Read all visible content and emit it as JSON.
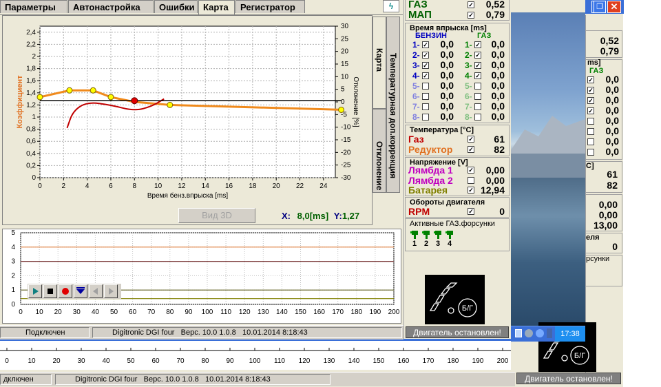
{
  "tabs": [
    "Параметры",
    "Автонастройка",
    "Ошибки",
    "Карта",
    "Регистратор"
  ],
  "side_tabs": [
    "Карта",
    "Температурная доп.коррекция",
    "Отклонение"
  ],
  "chart_data": {
    "type": "line",
    "xlabel": "Время бенз.впрыска [ms]",
    "ylabel": "Коэффициент",
    "y2label": "Отклонение [%]",
    "xlim": [
      0,
      25
    ],
    "ylim": [
      0,
      2.5
    ],
    "y2lim": [
      -30,
      30
    ],
    "x_ticks": [
      0,
      2,
      4,
      6,
      8,
      10,
      12,
      14,
      16,
      18,
      20,
      22,
      24
    ],
    "y_ticks": [
      "0",
      "0,2",
      "0,4",
      "0,6",
      "0,8",
      "1",
      "1,2",
      "1,4",
      "1,6",
      "1,8",
      "2",
      "2,2",
      "2,4"
    ],
    "y2_ticks": [
      "30",
      "25",
      "20",
      "15",
      "10",
      "5",
      "0",
      "-5",
      "-10",
      "-15",
      "-20",
      "-25",
      "-30"
    ],
    "grid": true,
    "series": [
      {
        "color": "#f08a1c",
        "points": [
          [
            0,
            1.33
          ],
          [
            2.5,
            1.44
          ],
          [
            4.5,
            1.44
          ],
          [
            6,
            1.33
          ],
          [
            8,
            1.25
          ],
          [
            11,
            1.2
          ],
          [
            25.5,
            1.12
          ]
        ],
        "markers_x": [
          0,
          2.5,
          4.5,
          6,
          11,
          25.5
        ]
      },
      {
        "color": "#c00000",
        "points": [
          [
            2.3,
            0.82
          ],
          [
            2.8,
            1.1
          ],
          [
            4,
            1.25
          ],
          [
            6,
            1.2
          ],
          [
            8,
            1.1
          ],
          [
            9.5,
            1.18
          ],
          [
            10.5,
            1.3
          ]
        ]
      },
      {
        "color": "#000000",
        "points": [
          [
            0,
            1.27
          ],
          [
            25.5,
            1.27
          ]
        ]
      }
    ],
    "selected_point": [
      8,
      1.27
    ]
  },
  "view3d_label": "Вид 3D",
  "cursor": {
    "x_label": "X:",
    "x_value": "8,0[ms]",
    "y_label": "Y:",
    "y_value": "1,27"
  },
  "lower_chart": {
    "type": "line",
    "x_ticks": [
      0,
      10,
      20,
      30,
      40,
      50,
      60,
      70,
      80,
      90,
      100,
      110,
      120,
      130,
      140,
      150,
      160,
      170,
      180,
      190,
      200
    ],
    "y_ticks": [
      0,
      1,
      2,
      3,
      4,
      5
    ],
    "xlim": [
      0,
      200
    ],
    "ylim": [
      0,
      5
    ],
    "levels": [
      {
        "y": 4.0,
        "color": "#e08040"
      },
      {
        "y": 3.0,
        "color": "#804040"
      },
      {
        "y": 1.0,
        "color": "#606020"
      },
      {
        "y": 0.4,
        "color": "#808000"
      }
    ]
  },
  "back_axis_ticks": [
    0,
    10,
    20,
    30,
    40,
    50,
    60,
    70,
    80,
    90,
    100,
    110,
    120,
    130,
    140,
    150,
    160,
    170,
    180,
    190,
    200
  ],
  "status": {
    "connection": "Подключен",
    "device": "Digitronic DGI four",
    "version": "Верс. 10.0 1.0.8",
    "date": "10.01.2014 8:18:43"
  },
  "back_status": {
    "connection": "дключен",
    "device": "Digitronic DGI four",
    "version": "Верс. 10.0 1.0.8",
    "date": "10.01.2014 8:18:43"
  },
  "top_params": {
    "gas_label": "ГАЗ",
    "gas_value": "0,52",
    "map_label": "МАП",
    "map_value": "0,79"
  },
  "injection": {
    "title": "Время впрыска [ms]",
    "petrol_header": "БЕНЗИН",
    "gas_header": "ГАЗ",
    "rows": [
      {
        "n1": "1-",
        "checked1": true,
        "p": "0,0",
        "n2": "1-",
        "checked2": true,
        "g": "0,0"
      },
      {
        "n1": "2-",
        "checked1": true,
        "p": "0,0",
        "n2": "2-",
        "checked2": true,
        "g": "0,0"
      },
      {
        "n1": "3-",
        "checked1": true,
        "p": "0,0",
        "n2": "3-",
        "checked2": true,
        "g": "0,0"
      },
      {
        "n1": "4-",
        "checked1": true,
        "p": "0,0",
        "n2": "4-",
        "checked2": true,
        "g": "0,0"
      },
      {
        "n1": "5-",
        "checked1": false,
        "p": "0,0",
        "n2": "5-",
        "checked2": false,
        "g": "0,0"
      },
      {
        "n1": "6-",
        "checked1": false,
        "p": "0,0",
        "n2": "6-",
        "checked2": false,
        "g": "0,0"
      },
      {
        "n1": "7-",
        "checked1": false,
        "p": "0,0",
        "n2": "7-",
        "checked2": false,
        "g": "0,0"
      },
      {
        "n1": "8-",
        "checked1": false,
        "p": "0,0",
        "n2": "8-",
        "checked2": false,
        "g": "0,0"
      }
    ]
  },
  "temperature": {
    "title": "Температура [°C]",
    "gas_label": "Газ",
    "gas_value": "61",
    "reducer_label": "Редуктор",
    "reducer_value": "82"
  },
  "voltage": {
    "title": "Напряжение [V]",
    "lambda1_label": "Лямбда 1",
    "lambda1_value": "0,00",
    "lambda2_label": "Лямбда 2",
    "lambda2_value": "0,00",
    "battery_label": "Батарея",
    "battery_value": "12,94"
  },
  "rpm": {
    "title": "Обороты двигателя",
    "label": "RPM",
    "value": "0"
  },
  "active_injectors": {
    "title": "Активные ГАЗ.форсунки",
    "numbers": [
      "1",
      "2",
      "3",
      "4"
    ]
  },
  "logo_text": "Б/Г",
  "engine_status": "Двигатель остановлен!",
  "back_window": {
    "values_top": [
      "0,52",
      "0,79"
    ],
    "ms_label": "ms]",
    "gas_header": "ГАЗ",
    "gas_values": [
      "0,0",
      "0,0",
      "0,0",
      "0,0",
      "0,0",
      "0,0",
      "0,0",
      "0,0"
    ],
    "temp_unit": "С]",
    "temp_values": [
      "61",
      "82"
    ],
    "volt_values": [
      "0,00",
      "0,00",
      "13,00"
    ],
    "rpm_suffix": "еля",
    "rpm_value": "0",
    "injector_suffix": "рсунки",
    "engine_status": "Двигатель остановлен!"
  },
  "taskbar": {
    "time": "17:38"
  },
  "colors": {
    "window_bg": "#ece9d8",
    "title_blue": "#1c53d4",
    "orange": "#f08a1c",
    "red": "#c00000",
    "green": "#008000",
    "purple": "#c000c0",
    "brown": "#e07020"
  }
}
